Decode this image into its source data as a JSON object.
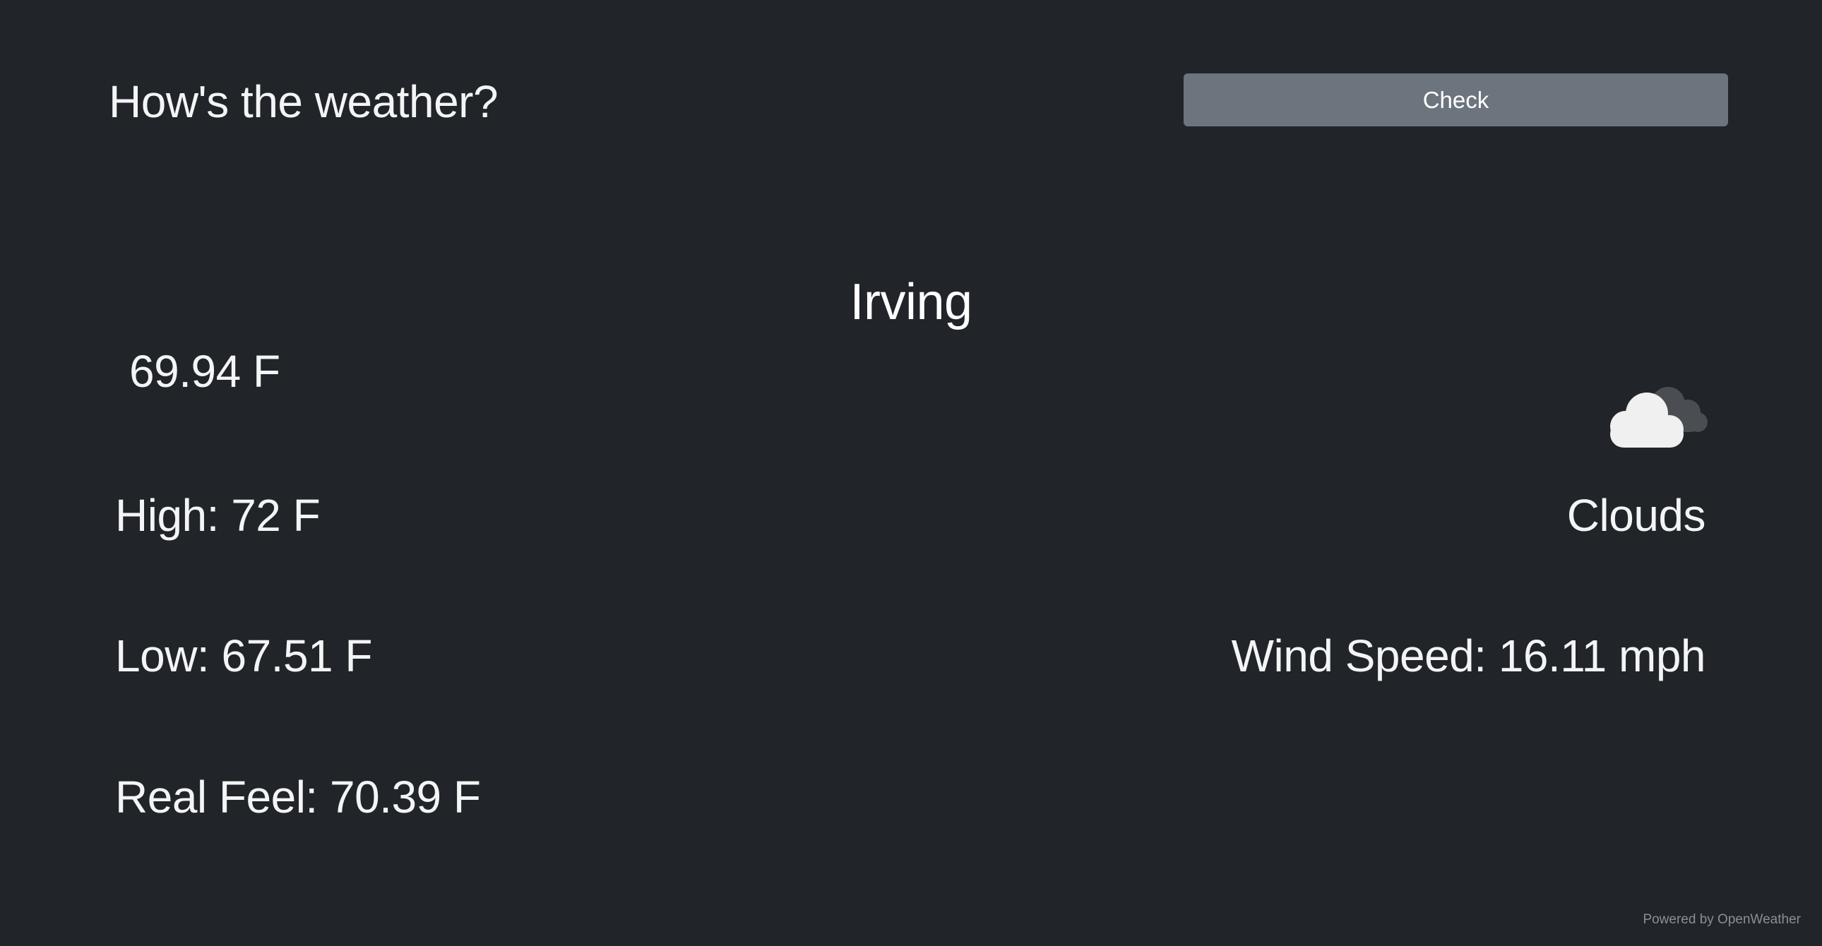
{
  "header": {
    "title": "How's the weather?",
    "check_button_label": "Check"
  },
  "weather": {
    "city": "Irving",
    "current_temp": "69.94 F",
    "high": "High: 72 F",
    "low": "Low: 67.51 F",
    "real_feel": "Real Feel: 70.39 F",
    "condition": "Clouds",
    "condition_icon": "broken-clouds-icon",
    "wind_speed": "Wind Speed: 16.11 mph"
  },
  "footer": {
    "attribution": "Powered by OpenWeather"
  },
  "colors": {
    "background": "#212529",
    "button": "#6c757d",
    "text": "#ffffff",
    "muted": "#8a8f94"
  }
}
